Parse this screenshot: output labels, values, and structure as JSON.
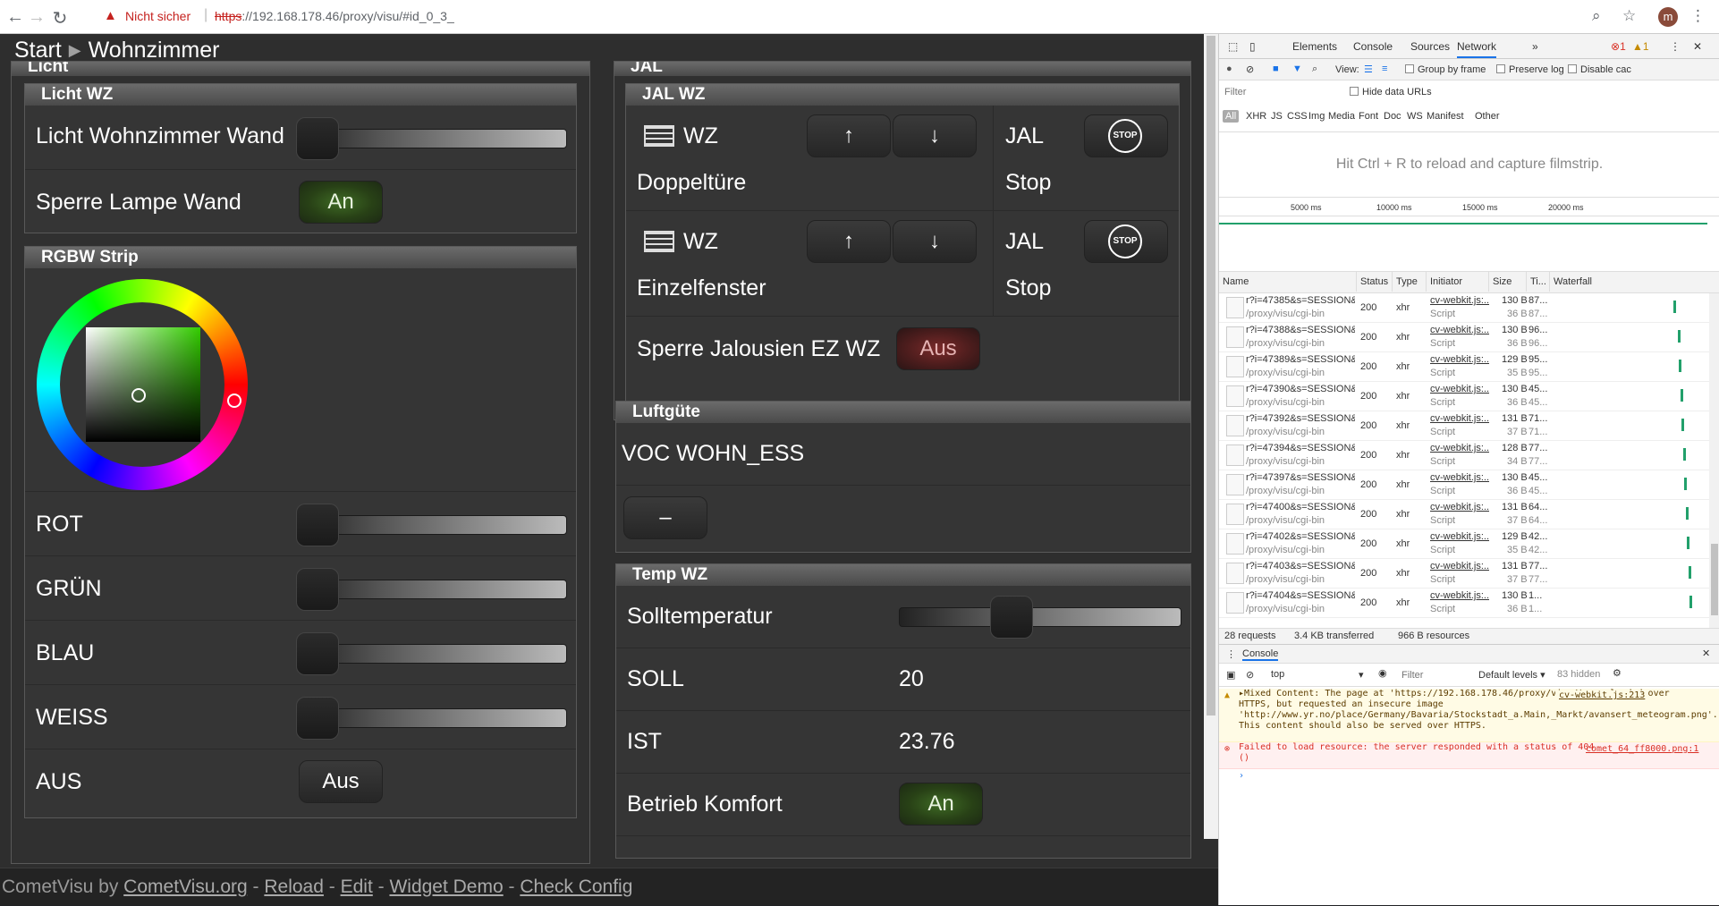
{
  "browser": {
    "security_label": "Nicht sicher",
    "url_scheme": "https",
    "url_rest": "://192.168.178.46/proxy/visu/#id_0_3_",
    "avatar_letter": "m"
  },
  "visu": {
    "breadcrumb": {
      "start": "Start",
      "current": "Wohnzimmer"
    },
    "left_section_title": "Licht",
    "right_section_title": "JAL",
    "licht_wz": {
      "title": "Licht WZ",
      "wand_label": "Licht Wohnzimmer Wand",
      "wand_level": 0,
      "sperre_label": "Sperre Lampe Wand",
      "sperre_state": "An"
    },
    "rgbw": {
      "title": "RGBW Strip",
      "colors": {
        "hue_accent": "#33cc00"
      },
      "rot_label": "ROT",
      "rot_level": 0,
      "gruen_label": "GRÜN",
      "gruen_level": 0,
      "blau_label": "BLAU",
      "blau_level": 0,
      "weiss_label": "WEISS",
      "weiss_level": 0,
      "aus_label": "AUS",
      "aus_button": "Aus"
    },
    "jal_wz": {
      "title": "JAL WZ",
      "items": [
        {
          "prefix": "WZ",
          "name": "Doppeltüre",
          "up": "↑",
          "down": "↓",
          "jal": "JAL",
          "stop_label": "Stop",
          "stop_icon": "STOP"
        },
        {
          "prefix": "WZ",
          "name": "Einzelfenster",
          "up": "↑",
          "down": "↓",
          "jal": "JAL",
          "stop_label": "Stop",
          "stop_icon": "STOP"
        }
      ],
      "sperre_label": "Sperre Jalousien EZ WZ",
      "sperre_state": "Aus"
    },
    "luftguete": {
      "title": "Luftgüte",
      "voc_label": "VOC WOHN_ESS",
      "voc_value": "–"
    },
    "temp_wz": {
      "title": "Temp WZ",
      "soll_temp_label": "Solltemperatur",
      "soll_temp_level": 0.38,
      "soll_label": "SOLL",
      "soll_value": "20",
      "ist_label": "IST",
      "ist_value": "23.76",
      "komfort_label": "Betrieb Komfort",
      "komfort_state": "An"
    },
    "footer": {
      "prefix": "CometVisu by ",
      "link1": "CometVisu.org",
      "link2": "Reload",
      "link3": "Edit",
      "link4": "Widget Demo",
      "link5": "Check Config",
      "sep": " - "
    }
  },
  "devtools": {
    "tabs": [
      "Elements",
      "Console",
      "Sources",
      "Network"
    ],
    "errors": "1",
    "warnings": "1",
    "toolbar": {
      "view": "View:",
      "group_by_frame": "Group by frame",
      "preserve_log": "Preserve log",
      "disable_cache": "Disable cac"
    },
    "filter_placeholder": "Filter",
    "hide_data_urls": "Hide data URLs",
    "type_filters": [
      "All",
      "XHR",
      "JS",
      "CSS",
      "Img",
      "Media",
      "Font",
      "Doc",
      "WS",
      "Manifest",
      "Other"
    ],
    "filmstrip_hint": "Hit Ctrl + R to reload and capture filmstrip.",
    "timeline_ticks": [
      "5000 ms",
      "10000 ms",
      "15000 ms",
      "20000 ms"
    ],
    "columns": [
      "Name",
      "Status",
      "Type",
      "Initiator",
      "Size",
      "Ti...",
      "Waterfall"
    ],
    "rows": [
      {
        "name": "r?i=47385&s=SESSION&...",
        "path": "/proxy/visu/cgi-bin",
        "status": "200",
        "type": "xhr",
        "initiator": "cv-webkit.js:...",
        "init2": "Script",
        "size": "130 B",
        "size2": "36 B",
        "time": "87...",
        "time2": "87..."
      },
      {
        "name": "r?i=47388&s=SESSION&...",
        "path": "/proxy/visu/cgi-bin",
        "status": "200",
        "type": "xhr",
        "initiator": "cv-webkit.js:...",
        "init2": "Script",
        "size": "130 B",
        "size2": "36 B",
        "time": "96...",
        "time2": "96..."
      },
      {
        "name": "r?i=47389&s=SESSION&...",
        "path": "/proxy/visu/cgi-bin",
        "status": "200",
        "type": "xhr",
        "initiator": "cv-webkit.js:...",
        "init2": "Script",
        "size": "129 B",
        "size2": "35 B",
        "time": "95...",
        "time2": "95..."
      },
      {
        "name": "r?i=47390&s=SESSION&...",
        "path": "/proxy/visu/cgi-bin",
        "status": "200",
        "type": "xhr",
        "initiator": "cv-webkit.js:...",
        "init2": "Script",
        "size": "130 B",
        "size2": "36 B",
        "time": "45...",
        "time2": "45..."
      },
      {
        "name": "r?i=47392&s=SESSION&...",
        "path": "/proxy/visu/cgi-bin",
        "status": "200",
        "type": "xhr",
        "initiator": "cv-webkit.js:...",
        "init2": "Script",
        "size": "131 B",
        "size2": "37 B",
        "time": "71...",
        "time2": "71..."
      },
      {
        "name": "r?i=47394&s=SESSION&...",
        "path": "/proxy/visu/cgi-bin",
        "status": "200",
        "type": "xhr",
        "initiator": "cv-webkit.js:...",
        "init2": "Script",
        "size": "128 B",
        "size2": "34 B",
        "time": "77...",
        "time2": "77..."
      },
      {
        "name": "r?i=47397&s=SESSION&...",
        "path": "/proxy/visu/cgi-bin",
        "status": "200",
        "type": "xhr",
        "initiator": "cv-webkit.js:...",
        "init2": "Script",
        "size": "130 B",
        "size2": "36 B",
        "time": "45...",
        "time2": "45..."
      },
      {
        "name": "r?i=47400&s=SESSION&...",
        "path": "/proxy/visu/cgi-bin",
        "status": "200",
        "type": "xhr",
        "initiator": "cv-webkit.js:...",
        "init2": "Script",
        "size": "131 B",
        "size2": "37 B",
        "time": "64...",
        "time2": "64..."
      },
      {
        "name": "r?i=47402&s=SESSION&...",
        "path": "/proxy/visu/cgi-bin",
        "status": "200",
        "type": "xhr",
        "initiator": "cv-webkit.js:...",
        "init2": "Script",
        "size": "129 B",
        "size2": "35 B",
        "time": "42...",
        "time2": "42..."
      },
      {
        "name": "r?i=47403&s=SESSION&...",
        "path": "/proxy/visu/cgi-bin",
        "status": "200",
        "type": "xhr",
        "initiator": "cv-webkit.js:...",
        "init2": "Script",
        "size": "131 B",
        "size2": "37 B",
        "time": "77...",
        "time2": "77..."
      },
      {
        "name": "r?i=47404&s=SESSION&...",
        "path": "/proxy/visu/cgi-bin",
        "status": "200",
        "type": "xhr",
        "initiator": "cv-webkit.js:...",
        "init2": "Script",
        "size": "130 B",
        "size2": "36 B",
        "time": "1...",
        "time2": "1..."
      }
    ],
    "summary": {
      "requests": "28 requests",
      "transferred": "3.4 KB transferred",
      "resources": "966 B resources"
    },
    "console": {
      "title": "Console",
      "context": "top",
      "filter_placeholder": "Filter",
      "levels": "Default levels ▾",
      "hidden": "83 hidden",
      "warning_text": "▸Mixed Content: The page at 'https://192.168.178.46/proxy/visu/' was loaded over HTTPS, but requested an insecure image 'http://www.yr.no/place/Germany/Bavaria/Stockstadt_a.Main,_Markt/avansert_meteogram.png'. This content should also be served over HTTPS.",
      "warning_src": "cv-webkit.js:213",
      "error_text": "Failed to load resource: the server responded with a status of 404 ()",
      "error_src": "comet_64_ff8000.png:1"
    }
  }
}
